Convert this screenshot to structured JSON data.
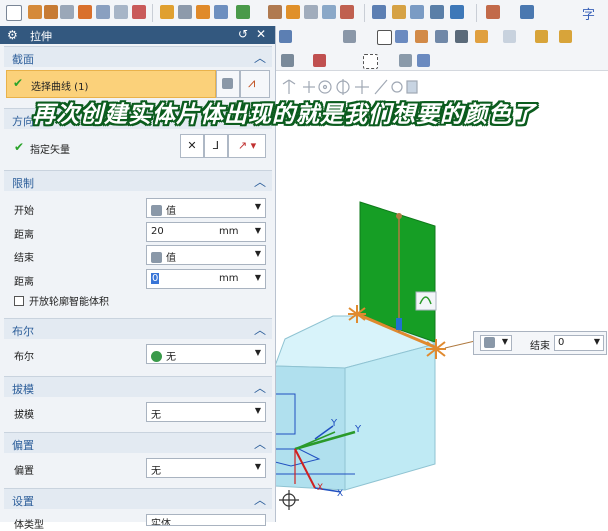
{
  "dialog": {
    "title": "拉伸",
    "section": {
      "jiemian": "截面",
      "fangxiang": "方向",
      "xianzhi": "限制",
      "buer": "布尔",
      "bamo": "拔模",
      "pianzhi": "偏置",
      "shezhi": "设置"
    },
    "select_curve": "选择曲线 (1)",
    "specify_vector": "指定矢量",
    "start_label": "开始",
    "start_value": "值",
    "distance1_label": "距离",
    "distance1_value": "20",
    "distance1_unit": "mm",
    "end_label": "结束",
    "end_value": "值",
    "distance2_label": "距离",
    "distance2_value": "0",
    "distance2_unit": "mm",
    "open_profile": "开放轮廓智能体积",
    "boolean_label": "布尔",
    "boolean_value": "无",
    "draft_label": "拔模",
    "draft_value": "无",
    "offset_label": "偏置",
    "offset_value": "无",
    "body_type_label": "体类型",
    "body_type_value": "实体"
  },
  "caption": "再次创建实体片体出现的就是我们想要的颜色了",
  "mini_toolbar": {
    "end_label": "结束",
    "end_value": "0"
  },
  "axis": {
    "y1": "Y",
    "y2": "Y",
    "x1": "X",
    "x2": "X"
  },
  "toolbar_text": "字",
  "icons": [
    "gear-icon",
    "reset-icon",
    "close-icon",
    "check-icon",
    "curve-select-icon",
    "vector-icon",
    "value-icon",
    "boolean-icon",
    "chevron-up-icon",
    "dropdown-arrow-icon"
  ],
  "colors": {
    "title_bar": "#33587f",
    "highlight": "#fbd17a",
    "section_header": "#e3eaf2",
    "green_sheet": "#169e25",
    "block": "#bfeaf4",
    "edge": "#e08a2f",
    "caption_outline": "#0b5c1e"
  }
}
